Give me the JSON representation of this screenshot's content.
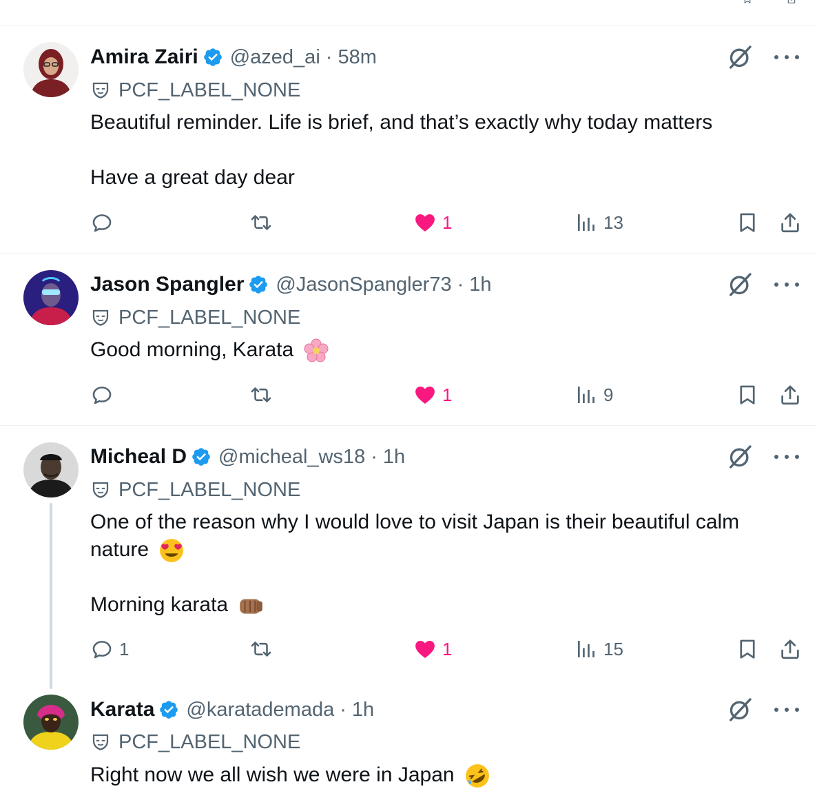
{
  "colors": {
    "verified": "#1d9bf0",
    "like": "#f91880",
    "secondary": "#536471",
    "text": "#0f1419",
    "divider": "#eff3f4"
  },
  "tweets": [
    {
      "name": "Amira Zairi",
      "handle": "@azed_ai",
      "separator": "·",
      "time": "58m",
      "label": "PCF_LABEL_NONE",
      "lines": [
        "Beautiful reminder. Life is brief, and that’s exactly why today matters",
        "Have a great day dear"
      ],
      "emoji": [],
      "replies": "",
      "likes": "1",
      "views": "13"
    },
    {
      "name": "Jason Spangler",
      "handle": "@JasonSpangler73",
      "separator": "·",
      "time": "1h",
      "label": "PCF_LABEL_NONE",
      "lines": [
        "Good morning, Karata"
      ],
      "emoji": [
        "cherry-blossom-emoji"
      ],
      "replies": "",
      "likes": "1",
      "views": "9"
    },
    {
      "name": "Micheal D",
      "handle": "@micheal_ws18",
      "separator": "·",
      "time": "1h",
      "label": "PCF_LABEL_NONE",
      "lines": [
        "One of the reason why I would love to visit Japan is their beautiful calm",
        "nature",
        "Morning karata"
      ],
      "emoji": [
        "heart-eyes-emoji",
        "fist-bump-emoji"
      ],
      "replies": "1",
      "likes": "1",
      "views": "15"
    },
    {
      "name": "Karata",
      "handle": "@karatademada",
      "separator": "·",
      "time": "1h",
      "label": "PCF_LABEL_NONE",
      "lines": [
        "Right now we all wish we were in Japan"
      ],
      "emoji": [
        "rolling-laughing-emoji"
      ]
    }
  ]
}
